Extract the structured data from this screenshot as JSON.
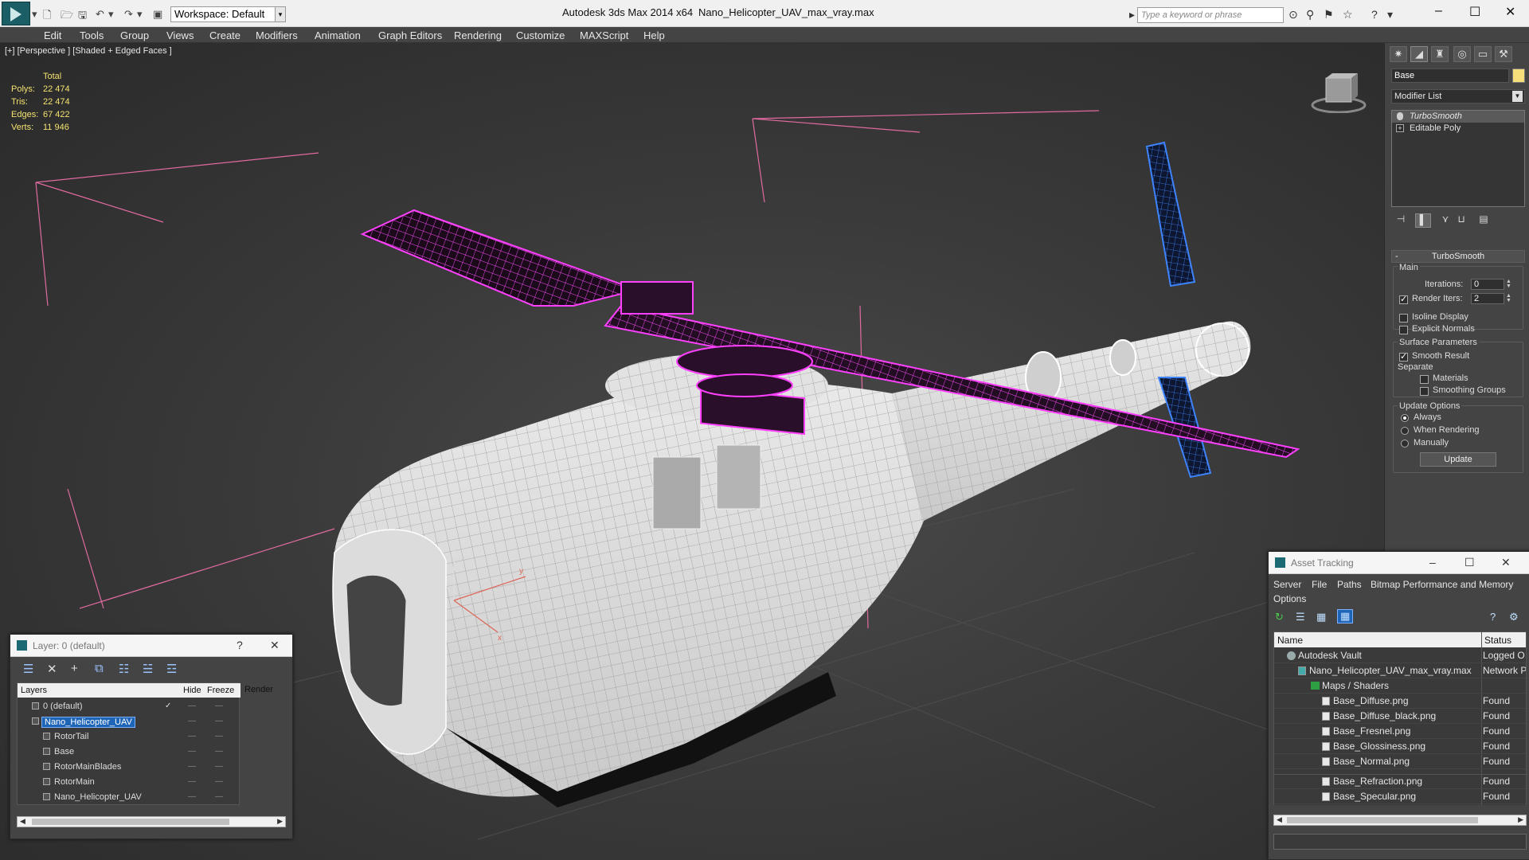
{
  "app": {
    "title": "Autodesk 3ds Max  2014 x64",
    "file": "Nano_Helicopter_UAV_max_vray.max",
    "workspace": "Workspace: Default",
    "search_placeholder": "Type a keyword or phrase"
  },
  "menu": [
    "Edit",
    "Tools",
    "Group",
    "Views",
    "Create",
    "Modifiers",
    "Animation",
    "Graph Editors",
    "Rendering",
    "Customize",
    "MAXScript",
    "Help"
  ],
  "viewport": {
    "label": "[+] [Perspective ] [Shaded + Edged Faces ]",
    "stats": {
      "header": "Total",
      "rows": [
        {
          "label": "Polys:",
          "value": "22 474"
        },
        {
          "label": "Tris:",
          "value": "22 474"
        },
        {
          "label": "Edges:",
          "value": "67 422"
        },
        {
          "label": "Verts:",
          "value": "11 946"
        }
      ]
    },
    "axes": {
      "x": "x",
      "y": "y",
      "z": "z"
    }
  },
  "command_panel": {
    "object_name": "Base",
    "object_color": "#f6df7a",
    "modifier_list": "Modifier List",
    "stack": [
      "TurboSmooth",
      "Editable Poly"
    ],
    "rollout": "TurboSmooth",
    "main": {
      "title": "Main",
      "iterations_label": "Iterations:",
      "iterations_value": "0",
      "render_iters_label": "Render Iters:",
      "render_iters_value": "2",
      "isoline_label": "Isoline Display",
      "explicit_label": "Explicit Normals"
    },
    "surface": {
      "title": "Surface Parameters",
      "smooth_label": "Smooth Result",
      "separate_label": "Separate",
      "materials_label": "Materials",
      "smoothing_label": "Smoothing Groups"
    },
    "update": {
      "title": "Update Options",
      "always": "Always",
      "when_rendering": "When Rendering",
      "manually": "Manually",
      "button": "Update"
    }
  },
  "layer_panel": {
    "title": "Layer: 0 (default)",
    "help": "?",
    "columns": {
      "layers": "Layers",
      "hide": "Hide",
      "freeze": "Freeze",
      "render": "Render"
    },
    "rows": [
      {
        "name": "0 (default)"
      },
      {
        "name": "Nano_Helicopter_UAV"
      },
      {
        "name": "RotorTail"
      },
      {
        "name": "Base"
      },
      {
        "name": "RotorMainBlades"
      },
      {
        "name": "RotorMain"
      },
      {
        "name": "Nano_Helicopter_UAV"
      }
    ]
  },
  "asset_panel": {
    "title": "Asset Tracking",
    "menu": [
      "Server",
      "File",
      "Paths",
      "Bitmap Performance and Memory",
      "Options"
    ],
    "columns": {
      "name": "Name",
      "status": "Status"
    },
    "rows": [
      {
        "name": "Autodesk Vault",
        "status": "Logged O"
      },
      {
        "name": "Nano_Helicopter_UAV_max_vray.max",
        "status": "Network P"
      },
      {
        "name": "Maps / Shaders",
        "status": ""
      },
      {
        "name": "Base_Diffuse.png",
        "status": "Found"
      },
      {
        "name": "Base_Diffuse_black.png",
        "status": "Found"
      },
      {
        "name": "Base_Fresnel.png",
        "status": "Found"
      },
      {
        "name": "Base_Glossiness.png",
        "status": "Found"
      },
      {
        "name": "Base_Normal.png",
        "status": "Found"
      },
      {
        "name": "Base_Refraction.png",
        "status": "Found"
      },
      {
        "name": "Base_Specular.png",
        "status": "Found"
      }
    ]
  }
}
